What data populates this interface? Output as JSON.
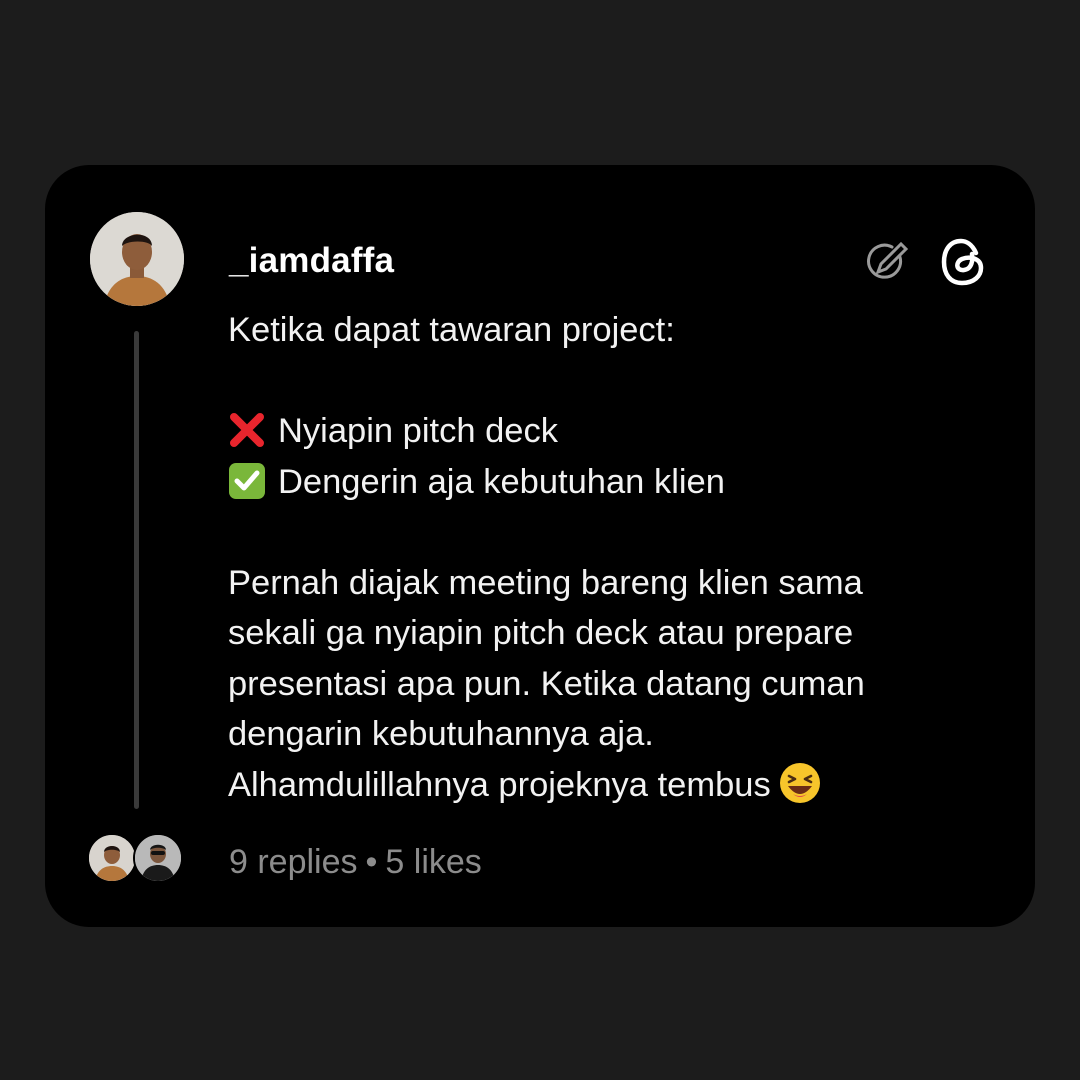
{
  "post": {
    "username": "_iamdaffa",
    "lines": [
      "Ketika dapat tawaran project:",
      "",
      "Nyiapin pitch deck",
      "Dengerin aja kebutuhan klien",
      "",
      "Pernah diajak meeting bareng klien sama",
      "sekali ga nyiapin pitch deck atau prepare",
      "presentasi apa pun. Ketika datang cuman",
      "dengarin kebutuhannya aja.",
      "Alhamdulillahnya projeknya tembus"
    ],
    "replies": "9 replies",
    "separator": "•",
    "likes": "5 likes"
  },
  "icons": {
    "wrong": "cross-mark-emoji",
    "right": "check-mark-emoji",
    "laugh": "laughing-face-emoji",
    "edit": "edit-pencil-icon",
    "brand": "threads-logo"
  },
  "colors": {
    "background": "#1c1c1c",
    "card": "#000000",
    "text": "#f2f2f2",
    "muted": "#8c8c8c",
    "thread_line": "#3a3a3a",
    "cross": "#e8252d",
    "check": "#7ab73a"
  }
}
